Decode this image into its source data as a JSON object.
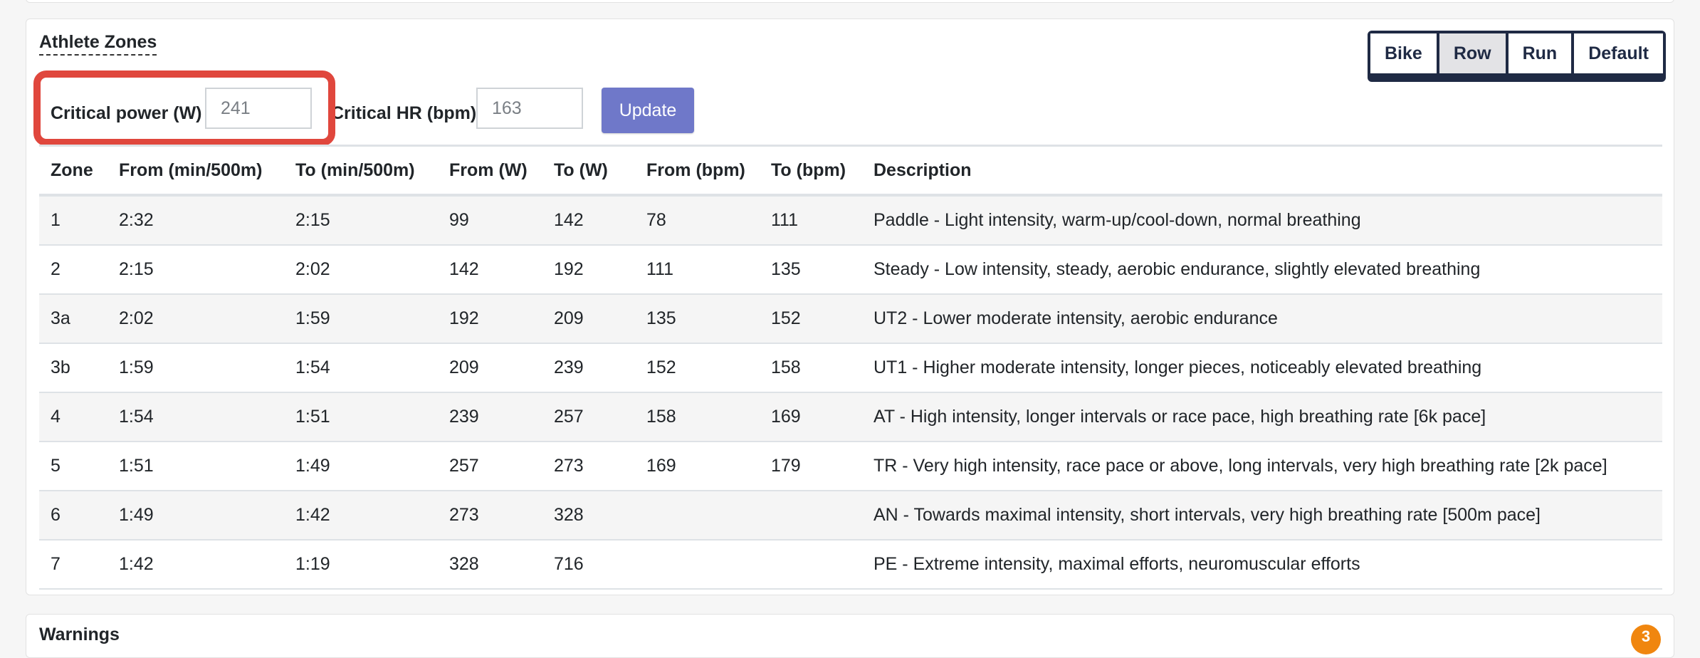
{
  "card": {
    "title": "Athlete Zones",
    "sport_buttons": [
      {
        "label": "Bike",
        "active": false
      },
      {
        "label": "Row",
        "active": true
      },
      {
        "label": "Run",
        "active": false
      },
      {
        "label": "Default",
        "active": false
      }
    ],
    "form": {
      "cp_label": "Critical power (W)",
      "cp_value": "241",
      "chr_label": "Critical HR (bpm)",
      "chr_value": "163",
      "update_label": "Update"
    },
    "table": {
      "headers": [
        "Zone",
        "From (min/500m)",
        "To (min/500m)",
        "From (W)",
        "To (W)",
        "From (bpm)",
        "To (bpm)",
        "Description"
      ],
      "rows": [
        [
          "1",
          "2:32",
          "2:15",
          "99",
          "142",
          "78",
          "111",
          "Paddle - Light intensity, warm-up/cool-down, normal breathing"
        ],
        [
          "2",
          "2:15",
          "2:02",
          "142",
          "192",
          "111",
          "135",
          "Steady - Low intensity, steady, aerobic endurance, slightly elevated breathing"
        ],
        [
          "3a",
          "2:02",
          "1:59",
          "192",
          "209",
          "135",
          "152",
          "UT2 - Lower moderate intensity, aerobic endurance"
        ],
        [
          "3b",
          "1:59",
          "1:54",
          "209",
          "239",
          "152",
          "158",
          "UT1 - Higher moderate intensity, longer pieces, noticeably elevated breathing"
        ],
        [
          "4",
          "1:54",
          "1:51",
          "239",
          "257",
          "158",
          "169",
          "AT - High intensity, longer intervals or race pace, high breathing rate [6k pace]"
        ],
        [
          "5",
          "1:51",
          "1:49",
          "257",
          "273",
          "169",
          "179",
          "TR - Very high intensity, race pace or above, long intervals, very high breathing rate [2k pace]"
        ],
        [
          "6",
          "1:49",
          "1:42",
          "273",
          "328",
          "",
          "",
          "AN - Towards maximal intensity, short intervals, very high breathing rate [500m pace]"
        ],
        [
          "7",
          "1:42",
          "1:19",
          "328",
          "716",
          "",
          "",
          "PE - Extreme intensity, maximal efforts, neuromuscular efforts"
        ]
      ]
    }
  },
  "bottom_card": {
    "title": "Warnings",
    "badge": "3"
  },
  "colors": {
    "highlight": "#e0473d",
    "update_button": "#6f78c9",
    "segment_border": "#1f2a44",
    "badge": "#f0860f"
  }
}
